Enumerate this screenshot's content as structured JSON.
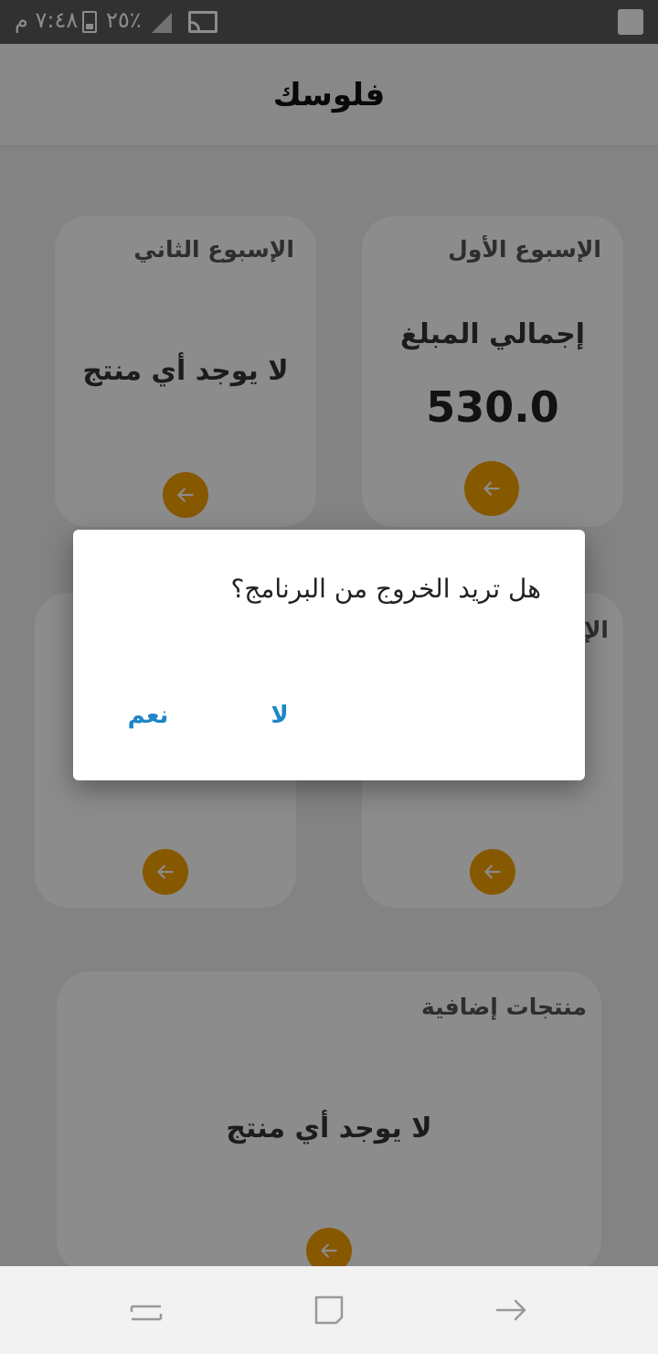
{
  "status_bar": {
    "time": "٧:٤٨ م",
    "battery_percent": "٢٥٪",
    "icons": [
      "battery-charging-icon",
      "signal-icon",
      "cast-icon",
      "notification-square-icon"
    ]
  },
  "app": {
    "title": "فلوسك"
  },
  "cards": [
    {
      "title": "الإسبوع الأول",
      "label": "إجمالي المبلغ",
      "amount": "530.0"
    },
    {
      "title": "الإسبوع الثاني",
      "label": "لا يوجد أي منتج"
    },
    {
      "title": "الإ"
    },
    {
      "title": ""
    },
    {
      "title": "منتجات إضافية",
      "label": "لا يوجد أي منتج"
    }
  ],
  "dialog": {
    "message": "هل تريد الخروج من البرنامج؟",
    "no_label": "لا",
    "yes_label": "نعم"
  },
  "colors": {
    "accent": "#f5a100",
    "dialog_button": "#1f86c8"
  },
  "nav_bar": {
    "icons": [
      "back-icon",
      "home-icon",
      "recents-icon"
    ]
  }
}
